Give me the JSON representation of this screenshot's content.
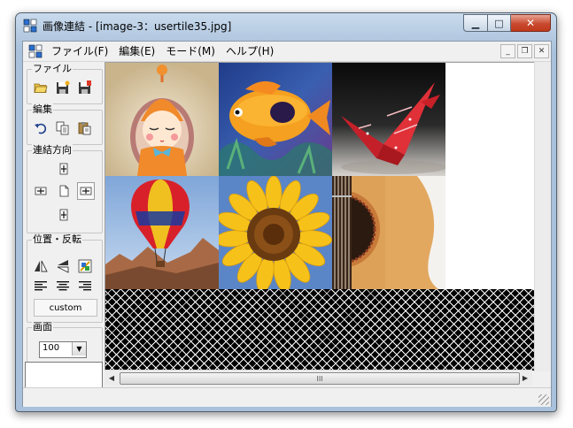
{
  "window": {
    "title": "画像連結 - [image-3：usertile35.jpg]",
    "caption_buttons": {
      "minimize": "minimize-icon",
      "maximize": "maximize-icon",
      "close": "close-icon"
    }
  },
  "menu": {
    "items": [
      "ファイル(F)",
      "編集(E)",
      "モード(M)",
      "ヘルプ(H)"
    ]
  },
  "panel": {
    "file": {
      "label": "ファイル",
      "icons": [
        "open-folder-icon",
        "save-as-icon",
        "save-icon"
      ]
    },
    "edit": {
      "label": "編集",
      "icons": [
        "undo-icon",
        "copy-icon",
        "paste-icon"
      ]
    },
    "direction": {
      "label": "連結方向",
      "icons": [
        "join-up-icon",
        "join-left-icon",
        "new-page-icon",
        "join-right-icon",
        "join-down-icon"
      ],
      "selected": "join-right-icon"
    },
    "position": {
      "label": "位置・反転",
      "icons": [
        "flip-horizontal-icon",
        "flip-vertical-icon",
        "rotate-icon",
        "align-left-icon",
        "align-center-icon",
        "align-right-icon"
      ],
      "custom_label": "custom"
    },
    "screen": {
      "label": "画面",
      "zoom": "100"
    }
  },
  "canvas": {
    "tiles": [
      {
        "name": "doll-tile",
        "desc": "doll"
      },
      {
        "name": "fish-tile",
        "desc": "fish"
      },
      {
        "name": "origami-crane-tile",
        "desc": "crane"
      },
      {
        "name": "hot-air-balloon-tile",
        "desc": "balloon"
      },
      {
        "name": "sunflower-tile",
        "desc": "sunflower"
      },
      {
        "name": "guitar-tile",
        "desc": "guitar"
      }
    ]
  },
  "scroll": {
    "thumb_grip": "III"
  }
}
